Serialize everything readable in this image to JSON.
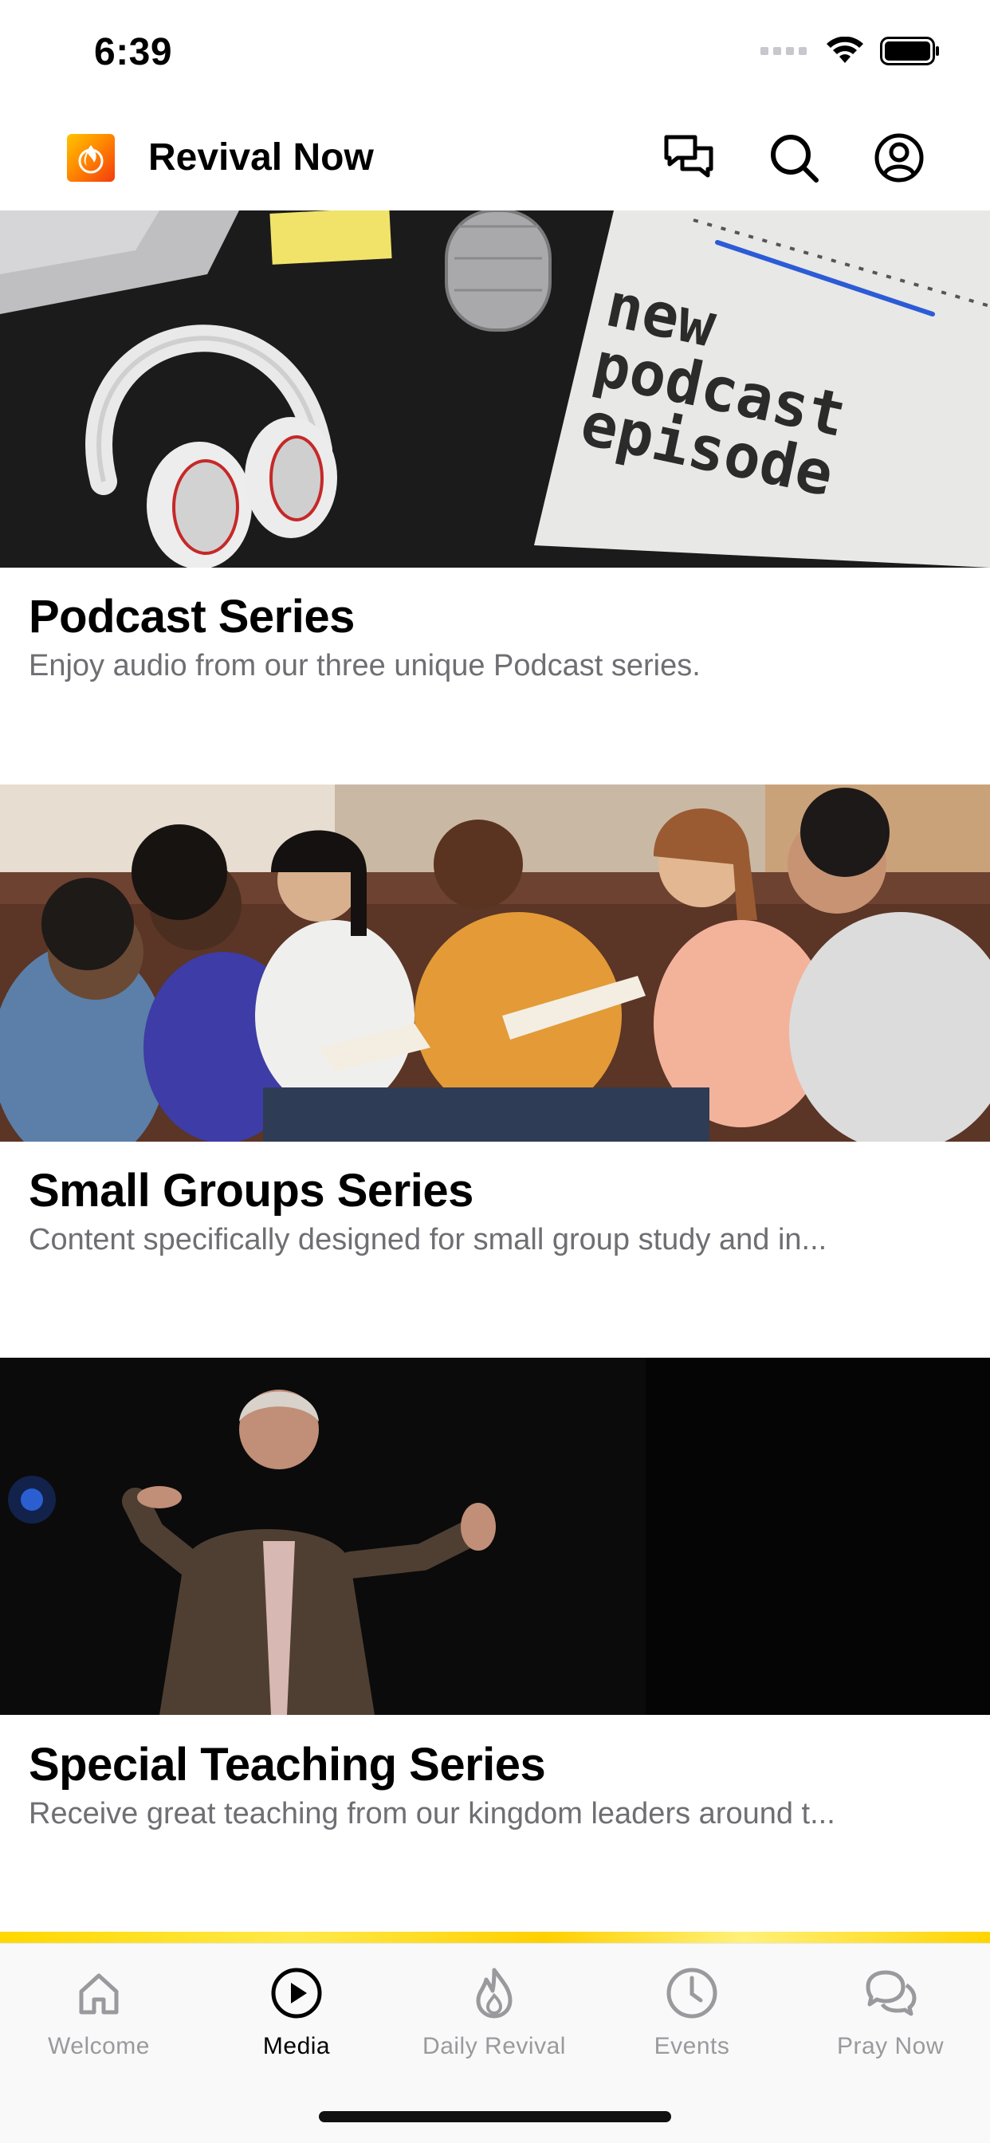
{
  "status_bar": {
    "time": "6:39"
  },
  "header": {
    "app_title": "Revival Now"
  },
  "cards": [
    {
      "title": "Podcast Series",
      "subtitle": "Enjoy audio from our three unique Podcast series.",
      "image_text": [
        "new",
        "podcast",
        "episode"
      ]
    },
    {
      "title": "Small Groups Series",
      "subtitle": "Content specifically designed for small group study and in..."
    },
    {
      "title": "Special Teaching Series",
      "subtitle": "Receive great teaching from our kingdom leaders around t..."
    }
  ],
  "tabs": [
    {
      "label": "Welcome",
      "icon": "home-icon",
      "active": false
    },
    {
      "label": "Media",
      "icon": "play-circle-icon",
      "active": true
    },
    {
      "label": "Daily Revival",
      "icon": "flame-icon",
      "active": false
    },
    {
      "label": "Events",
      "icon": "clock-icon",
      "active": false
    },
    {
      "label": "Pray Now",
      "icon": "chat-bubbles-icon",
      "active": false
    }
  ],
  "colors": {
    "accent": "#ffd800",
    "inactive": "#9a9a9e",
    "subtitle": "#6e6e73"
  }
}
